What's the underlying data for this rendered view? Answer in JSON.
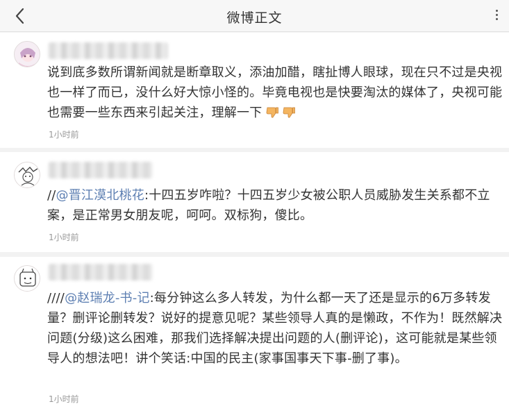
{
  "header": {
    "title": "微博正文",
    "back_icon": "chevron-left-icon",
    "more_icon": "more-vertical-icon"
  },
  "comments": [
    {
      "text": "说到底多数所谓新闻就是断章取义，添油加醋，瞎扯博人眼球，现在只不过是央视也一样了而已，没什么好大惊小怪的。毕竟电视也是快要淘汰的媒体了，央视可能也需要一些东西来引起关注，理解一下",
      "emojis": [
        "thumbs-down-icon",
        "thumbs-down-icon"
      ],
      "time": "1小时前"
    },
    {
      "prefix": "//",
      "mention": "@晋江漠北桃花",
      "text": ":十四五岁咋啦？十四五岁少女被公职人员威胁发生关系都不立案，是正常男女朋友呢，呵呵。双标狗，傻比。",
      "time": "1小时前"
    },
    {
      "prefix": "////",
      "mention": "@赵瑞龙-书-记",
      "text": ":每分钟这么多人转发，为什么都一天了还是显示的6万多转发量？删评论删转发？说好的提意见呢？某些领导人真的是懒政，不作为！既然解决问题(分级)这么困难，那我们选择解决提出问题的人(删评论)，这可能就是某些领导人的想法吧！讲个笑话:中国的民主(家事国事天下事-删了事)。",
      "time": "1小时前"
    }
  ],
  "colors": {
    "mention": "#5d7fb2",
    "time": "#999999",
    "text": "#333333",
    "background": "#f2f2f2"
  }
}
